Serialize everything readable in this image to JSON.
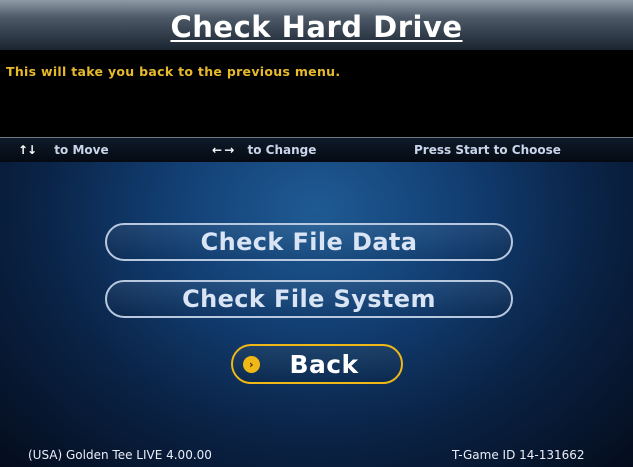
{
  "screen": {
    "title": "Check Hard Drive",
    "description": "This will take you back to the previous menu."
  },
  "help": {
    "move_icon": "↑↓",
    "move_text": "to Move",
    "change_icon": "← →",
    "change_text": "to Change",
    "start_text": "Press Start to Choose"
  },
  "menu": {
    "items": [
      {
        "label": "Check File Data",
        "selected": false
      },
      {
        "label": "Check File System",
        "selected": false
      },
      {
        "label": "Back",
        "selected": true
      }
    ],
    "cursor_icon": "›"
  },
  "footer": {
    "version": "(USA) Golden Tee LIVE 4.00.00",
    "game_id": "T-Game ID 14-131662"
  },
  "colors": {
    "title_text": "#ffffff",
    "description_text": "#e7ba2b",
    "selected_outline": "#f0b817",
    "menu_text": "#d9e4f5",
    "background": "#123f74"
  },
  "icons": [
    "up-down-arrows-icon",
    "left-right-arrows-icon",
    "selection-cursor-icon"
  ]
}
